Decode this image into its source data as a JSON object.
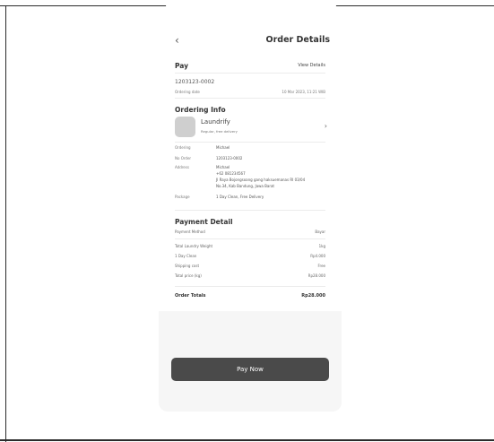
{
  "header": {
    "back_icon": "chevron-left-icon",
    "title": "Order Details"
  },
  "pay": {
    "label": "Pay",
    "view_details": "View Details",
    "order_id": "1203123-0002",
    "ordering_date_label": "Ordering date",
    "ordering_date_value": "10 Mar 2023, 11:21 WIB"
  },
  "ordering_info": {
    "title": "Ordering Info",
    "service_name": "Laundrify",
    "service_sub": "Regular, free delivery",
    "rows": {
      "ordering_k": "Ordering",
      "ordering_v": "Michael",
      "no_order_k": "No Order",
      "no_order_v": "1203123-0002",
      "address_k": "Address",
      "address_v1": "Michael",
      "address_v2": "+62 081234567",
      "address_v3": "Jl Raya Bojongsoang gang haksuemanas RI 03/04",
      "address_v4": "No.34, Kab Bandung, Jawa Barat",
      "package_k": "Package",
      "package_v": "1 Day Clean, Free Delivery"
    }
  },
  "payment_detail": {
    "title": "Payment Detail",
    "method_label": "Payment Method",
    "method_value": "Bayar",
    "rows": [
      {
        "label": "Total Laundry Weight",
        "value": "1kg"
      },
      {
        "label": "1 Day Clean",
        "value": "Rp4.000"
      },
      {
        "label": "Shipping cost",
        "value": "Free"
      },
      {
        "label": "Total price (kg)",
        "value": "Rp28.000"
      }
    ],
    "totals_label": "Order Totals",
    "totals_value": "Rp28.000"
  },
  "actions": {
    "pay_now": "Pay Now"
  }
}
